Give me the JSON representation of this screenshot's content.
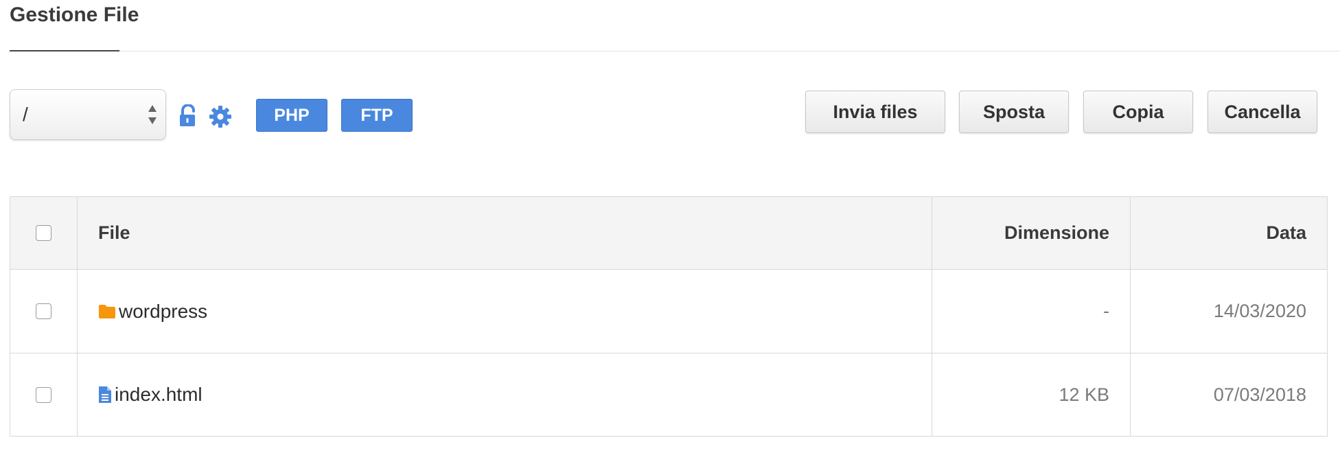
{
  "page": {
    "title": "Gestione File"
  },
  "toolbar": {
    "path_value": "/",
    "php_label": "PHP",
    "ftp_label": "FTP",
    "upload_label": "Invia files",
    "move_label": "Sposta",
    "copy_label": "Copia",
    "delete_label": "Cancella"
  },
  "icons": {
    "lock": "lock-open-icon",
    "settings": "gear-icon",
    "folder": "folder-icon",
    "file": "file-icon"
  },
  "colors": {
    "accent": "#4a88df",
    "folder": "#f5960c",
    "file": "#4a88df"
  },
  "table": {
    "columns": {
      "file": "File",
      "size": "Dimensione",
      "date": "Data"
    },
    "rows": [
      {
        "type": "folder",
        "name": "wordpress",
        "size": "-",
        "date": "14/03/2020"
      },
      {
        "type": "file",
        "name": "index.html",
        "size": "12 KB",
        "date": "07/03/2018"
      }
    ]
  }
}
